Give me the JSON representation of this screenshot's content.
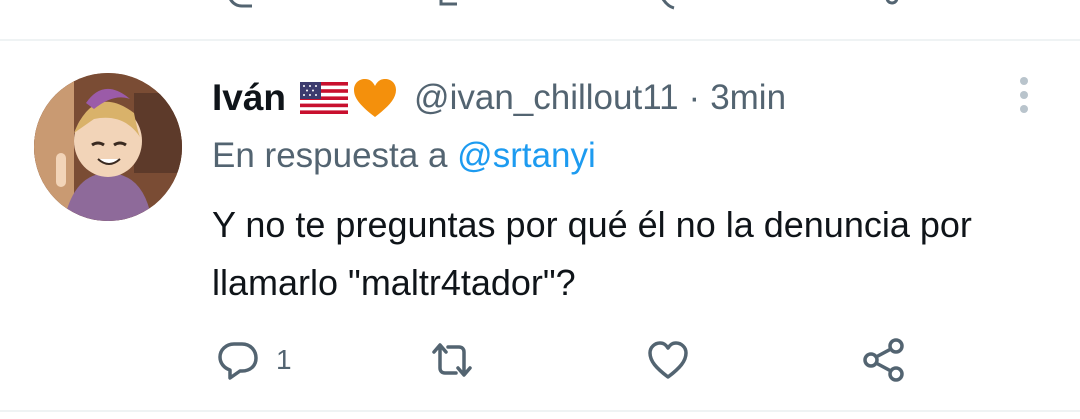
{
  "tweet": {
    "author_name": "Iván",
    "handle": "@ivan_chillout11",
    "separator": "·",
    "time_ago": "3min",
    "reply_prefix": "En respuesta a",
    "reply_to": "@srtanyi",
    "text": "Y no te preguntas por qué él no la denuncia por llamarlo \"maltr4tador\"?",
    "badges": [
      "us-flag-icon",
      "orange-heart-icon"
    ],
    "avatar": "avatar-image",
    "actions": {
      "reply_count": "1",
      "retweet_count": "",
      "like_count": ""
    }
  },
  "colors": {
    "primary_text": "#0f1419",
    "secondary_text": "#536471",
    "mention_blue": "#1d9bf0",
    "heart_orange": "#f4900c",
    "divider": "#eff3f4"
  },
  "icons": [
    "reply-icon",
    "retweet-icon",
    "like-icon",
    "share-icon",
    "more-options-icon"
  ]
}
